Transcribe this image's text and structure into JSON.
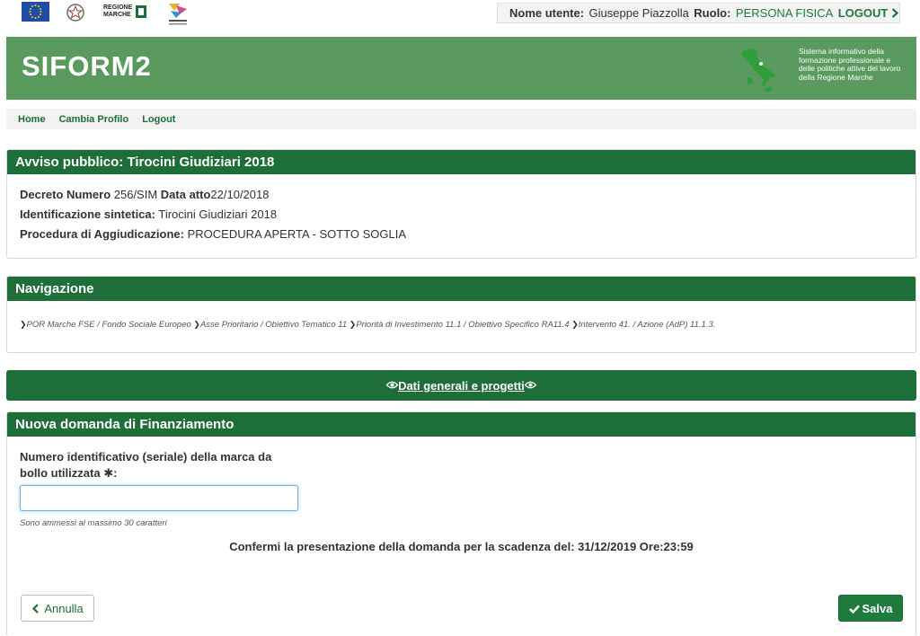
{
  "user": {
    "name_label": "Nome utente:",
    "name_value": "Giuseppe Piazzolla",
    "role_label": "Ruolo:",
    "role_value": "PERSONA FISICA",
    "logout_label": "LOGOUT",
    "logout_icon": "chevron-right-icon"
  },
  "logos": {
    "regione_line1": "REGIONE",
    "regione_line2": "MARCHE"
  },
  "header": {
    "title": "SIFORM2",
    "description": "Sistema informativo della formazione professionale e delle politiche attive del lavoro della Regione Marche"
  },
  "menu": [
    "Home",
    "Cambia Profilo",
    "Logout"
  ],
  "avviso": {
    "title": "Avviso pubblico: Tirocini Giudiziari 2018",
    "decreto_label": "Decreto Numero",
    "decreto_value": " 256/SIM ",
    "data_label": "Data atto",
    "data_value": "22/10/2018",
    "ident_label": "Identificazione sintetica:",
    "ident_value": " Tirocini Giudiziari 2018",
    "proc_label": "Procedura di Aggiudicazione:",
    "proc_value": " PROCEDURA APERTA - SOTTO SOGLIA"
  },
  "navigazione": {
    "title": "Navigazione",
    "crumbs": [
      "POR Marche FSE / Fondo Sociale Europeo",
      "Asse Prioritario / Obiettivo Tematico 11",
      "Priorità di Investimento 11.1 / Obiettivo Specifico RA11.4",
      "Intervento 41. / Azione (AdP) 11.1.3."
    ]
  },
  "dati_generali": {
    "label": "Dati generali e progetti",
    "icon": "eye-icon"
  },
  "domanda": {
    "title": "Nuova domanda di Finanziamento",
    "field_label": "Numero identificativo (seriale) della marca da bollo utilizzata",
    "required_mark": "✱",
    "field_label_colon": ":",
    "input_value": "",
    "hint": "Sono ammessi al massimo 30 caratteri",
    "confirm_text": "Confermi la presentazione della domanda per la scadenza del: 31/12/2019 Ore:23:59",
    "cancel_label": "Annulla",
    "save_label": "Salva"
  },
  "colors": {
    "brand_green": "#1e6e3a",
    "banner_green": "#5a9a5e"
  }
}
